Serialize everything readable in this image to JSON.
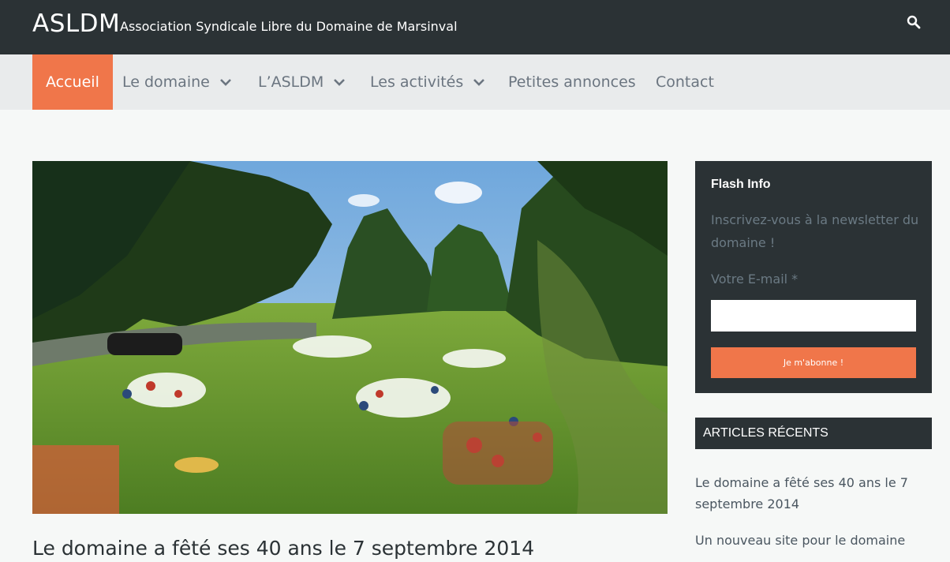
{
  "header": {
    "site_title": "ASLDM",
    "site_description": "Association Syndicale Libre du Domaine de Marsinval",
    "search_icon": "search-icon"
  },
  "nav": {
    "items": [
      {
        "label": "Accueil",
        "active": true,
        "dropdown": false
      },
      {
        "label": "Le domaine",
        "active": false,
        "dropdown": true
      },
      {
        "label": "L’ASLDM",
        "active": false,
        "dropdown": true
      },
      {
        "label": "Les activités",
        "active": false,
        "dropdown": true
      },
      {
        "label": "Petites annonces",
        "active": false,
        "dropdown": false
      },
      {
        "label": "Contact",
        "active": false,
        "dropdown": false
      }
    ]
  },
  "main": {
    "post_title": "Le domaine a fêté ses 40 ans le 7 septembre 2014"
  },
  "sidebar": {
    "flash": {
      "title": "Flash Info",
      "text": "Inscrivez-vous à la newsletter du domaine !",
      "email_label": "Votre E-mail *",
      "email_value": "",
      "subscribe_label": "Je m'abonne !"
    },
    "recent": {
      "heading": "ARTICLES RÉCENTS",
      "links": [
        "Le domaine a fêté ses 40 ans le 7 septembre 2014",
        "Un nouveau site pour le domaine"
      ]
    }
  },
  "colors": {
    "dark": "#2b3235",
    "accent": "#f0764a",
    "nav_bg": "#e9ebec",
    "page_bg": "#f6f8f7"
  }
}
